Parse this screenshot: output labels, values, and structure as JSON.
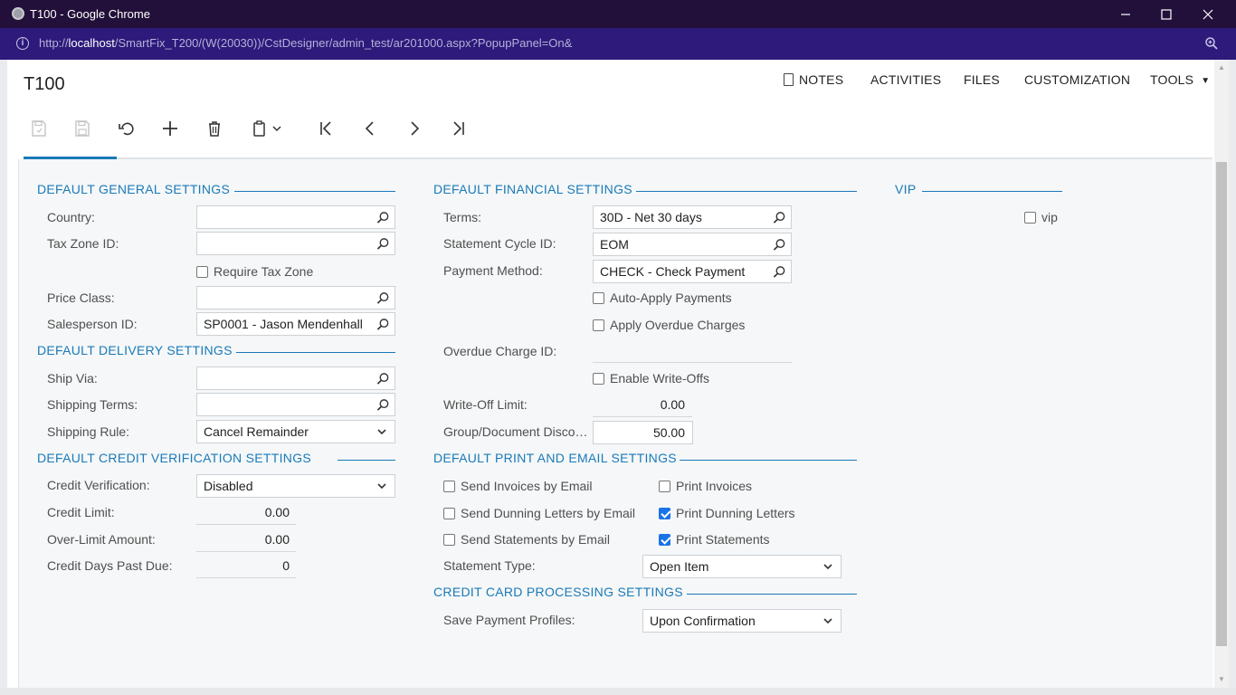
{
  "window": {
    "title": "T100 - Google Chrome",
    "url_prefix": "http://",
    "url_host": "localhost",
    "url_path": "/SmartFix_T200/(W(20030))/CstDesigner/admin_test/ar201000.aspx?PopupPanel=On&"
  },
  "header": {
    "title": "T100",
    "nav": {
      "notes": "NOTES",
      "activities": "ACTIVITIES",
      "files": "FILES",
      "customization": "CUSTOMIZATION",
      "tools": "TOOLS"
    }
  },
  "general": {
    "title": "DEFAULT GENERAL SETTINGS",
    "country_label": "Country:",
    "country_value": "",
    "tax_zone_label": "Tax Zone ID:",
    "tax_zone_value": "",
    "require_tax_zone_label": "Require Tax Zone",
    "require_tax_zone_checked": false,
    "price_class_label": "Price Class:",
    "price_class_value": "",
    "salesperson_label": "Salesperson ID:",
    "salesperson_value": "SP0001 - Jason Mendenhall"
  },
  "delivery": {
    "title": "DEFAULT DELIVERY SETTINGS",
    "ship_via_label": "Ship Via:",
    "ship_via_value": "",
    "shipping_terms_label": "Shipping Terms:",
    "shipping_terms_value": "",
    "shipping_rule_label": "Shipping Rule:",
    "shipping_rule_value": "Cancel Remainder"
  },
  "credit": {
    "title": "DEFAULT CREDIT VERIFICATION SETTINGS",
    "verification_label": "Credit Verification:",
    "verification_value": "Disabled",
    "limit_label": "Credit Limit:",
    "limit_value": "0.00",
    "over_limit_label": "Over-Limit Amount:",
    "over_limit_value": "0.00",
    "days_past_due_label": "Credit Days Past Due:",
    "days_past_due_value": "0"
  },
  "financial": {
    "title": "DEFAULT FINANCIAL SETTINGS",
    "terms_label": "Terms:",
    "terms_value": "30D - Net 30 days",
    "statement_cycle_label": "Statement Cycle ID:",
    "statement_cycle_value": "EOM",
    "payment_method_label": "Payment Method:",
    "payment_method_value": "CHECK - Check Payment",
    "auto_apply_label": "Auto-Apply Payments",
    "auto_apply_checked": false,
    "apply_overdue_label": "Apply Overdue Charges",
    "apply_overdue_checked": false,
    "overdue_charge_label": "Overdue Charge ID:",
    "overdue_charge_value": "",
    "enable_writeoffs_label": "Enable Write-Offs",
    "enable_writeoffs_checked": false,
    "writeoff_limit_label": "Write-Off Limit:",
    "writeoff_limit_value": "0.00",
    "group_doc_label": "Group/Document Disco…",
    "group_doc_value": "50.00"
  },
  "print_email": {
    "title": "DEFAULT PRINT AND EMAIL SETTINGS",
    "send_invoices_label": "Send Invoices by Email",
    "send_invoices_checked": false,
    "print_invoices_label": "Print Invoices",
    "print_invoices_checked": false,
    "send_dunning_label": "Send Dunning Letters by Email",
    "send_dunning_checked": false,
    "print_dunning_label": "Print Dunning Letters",
    "print_dunning_checked": true,
    "send_statements_label": "Send Statements by Email",
    "send_statements_checked": false,
    "print_statements_label": "Print Statements",
    "print_statements_checked": true,
    "statement_type_label": "Statement Type:",
    "statement_type_value": "Open Item"
  },
  "cc": {
    "title": "CREDIT CARD PROCESSING SETTINGS",
    "save_profiles_label": "Save Payment Profiles:",
    "save_profiles_value": "Upon Confirmation"
  },
  "vip": {
    "title": "VIP",
    "vip_label": "vip",
    "vip_checked": false
  },
  "colors": {
    "accent": "#1a7ab8",
    "titlebar": "#22103a",
    "addressbar": "#2d1a7a"
  }
}
